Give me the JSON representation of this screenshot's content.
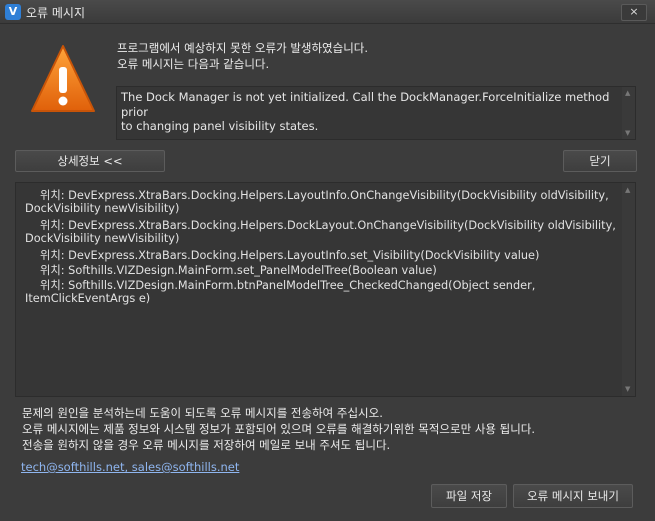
{
  "window": {
    "title": "오류 메시지",
    "icon": "app-logo-icon",
    "close_label": "×"
  },
  "message": {
    "line1": "프로그램에서 예상하지 못한 오류가 발생하였습니다.",
    "line2": "오류 메시지는 다음과 같습니다.",
    "error_line1": "The Dock Manager is not yet initialized. Call the DockManager.ForceInitialize method prior",
    "error_line2": "to changing panel visibility states."
  },
  "buttons": {
    "details": "상세정보 <<",
    "close": "닫기",
    "save_file": "파일 저장",
    "send": "오류 메시지 보내기"
  },
  "stack_trace": [
    "위치: DevExpress.XtraBars.Docking.Helpers.LayoutInfo.OnChangeVisibility(DockVisibility oldVisibility,",
    "DockVisibility newVisibility)",
    "위치: DevExpress.XtraBars.Docking.Helpers.DockLayout.OnChangeVisibility(DockVisibility oldVisibility,",
    "DockVisibility newVisibility)",
    "위치: DevExpress.XtraBars.Docking.Helpers.LayoutInfo.set_Visibility(DockVisibility value)",
    "위치: Softhills.VIZDesign.MainForm.set_PanelModelTree(Boolean value)",
    "위치: Softhills.VIZDesign.MainForm.btnPanelModelTree_CheckedChanged(Object sender,",
    "ItemClickEventArgs e)"
  ],
  "info": {
    "line1": "문제의 원인을 분석하는데 도움이 되도록 오류 메시지를 전송하여 주십시오.",
    "line2": "오류 메시지에는 제품 정보와 시스템 정보가 포함되어 있으며 오류를 해결하기위한 목적으로만 사용 됩니다.",
    "line3": "전송을 원하지 않을 경우 오류 메시지를 저장하여 메일로 보내 주셔도 됩니다.",
    "emails": "tech@softhills.net, sales@softhills.net"
  },
  "colors": {
    "warning": "#f07d12",
    "link": "#8fb6f0",
    "background": "#3c3c3c"
  }
}
